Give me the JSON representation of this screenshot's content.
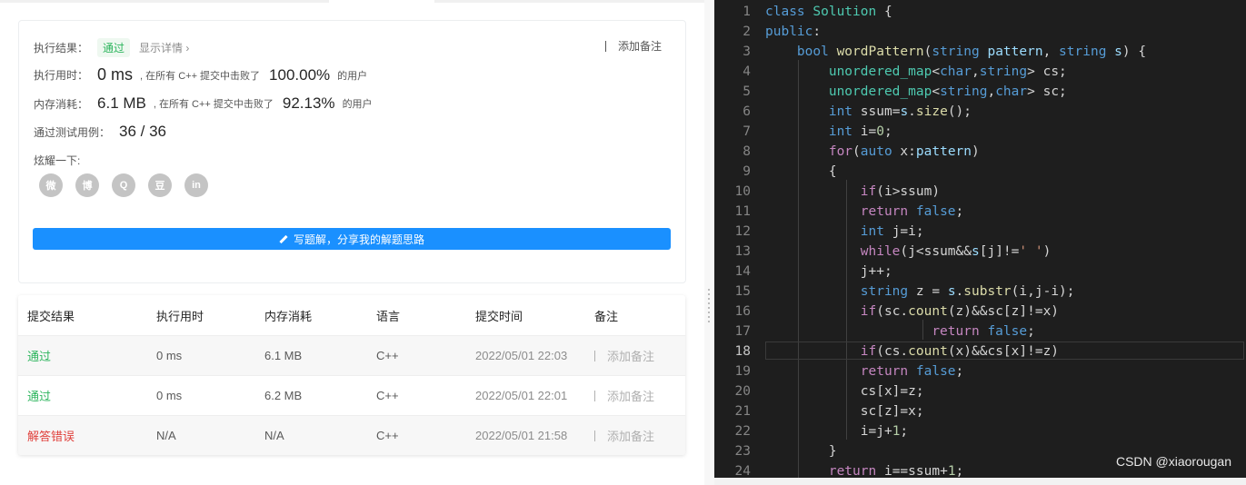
{
  "result": {
    "label": "执行结果：",
    "status": "通过",
    "details_link": "显示详情 ›",
    "add_note": "添加备注",
    "time_label": "执行用时：",
    "time_value": "0 ms",
    "time_beat_prefix": ", 在所有 C++ 提交中击败了",
    "time_percent": "100.00%",
    "users_suffix": "的用户",
    "mem_label": "内存消耗：",
    "mem_value": "6.1 MB",
    "mem_beat_prefix": ", 在所有 C++ 提交中击败了",
    "mem_percent": "92.13%",
    "cases_label": "通过测试用例：",
    "cases_value": "36 / 36",
    "share_label": "炫耀一下:",
    "share_icons": [
      "wechat-icon",
      "weibo-icon",
      "qq-icon",
      "douban-icon",
      "linkedin-icon"
    ],
    "share_glyphs": [
      "微",
      "博",
      "Q",
      "豆",
      "in"
    ],
    "write_button": "写题解，分享我的解题思路"
  },
  "table": {
    "headers": [
      "提交结果",
      "执行用时",
      "内存消耗",
      "语言",
      "提交时间",
      "备注"
    ],
    "rows": [
      {
        "result": "通过",
        "time": "0 ms",
        "memory": "6.1 MB",
        "lang": "C++",
        "date": "2022/05/01 22:03",
        "note": "添加备注"
      },
      {
        "result": "通过",
        "time": "0 ms",
        "memory": "6.2 MB",
        "lang": "C++",
        "date": "2022/05/01 22:01",
        "note": "添加备注"
      },
      {
        "result": "解答错误",
        "time": "N/A",
        "memory": "N/A",
        "lang": "C++",
        "date": "2022/05/01 21:58",
        "note": "添加备注"
      }
    ]
  },
  "editor": {
    "active_line": 18,
    "lines": [
      "class Solution {",
      "public:",
      "    bool wordPattern(string pattern, string s) {",
      "        unordered_map<char,string> cs;",
      "        unordered_map<string,char> sc;",
      "        int ssum=s.size();",
      "        int i=0;",
      "        for(auto x:pattern)",
      "        {",
      "            if(i>ssum)",
      "            return false;",
      "            int j=i;",
      "            while(j<ssum&&s[j]!=' ')",
      "            j++;",
      "            string z = s.substr(i,j-i);",
      "            if(sc.count(z)&&sc[z]!=x)",
      "                     return false;",
      "            if(cs.count(x)&&cs[x]!=z)",
      "            return false;",
      "            cs[x]=z;",
      "            sc[z]=x;",
      "            i=j+1;",
      "        }",
      "        return i==ssum+1;"
    ]
  },
  "watermark": "CSDN @xiaorougan",
  "colors": {
    "accent": "#1a90ff",
    "success": "#2db55d",
    "error": "#e0413c",
    "editor_bg": "#1e1e1e"
  }
}
